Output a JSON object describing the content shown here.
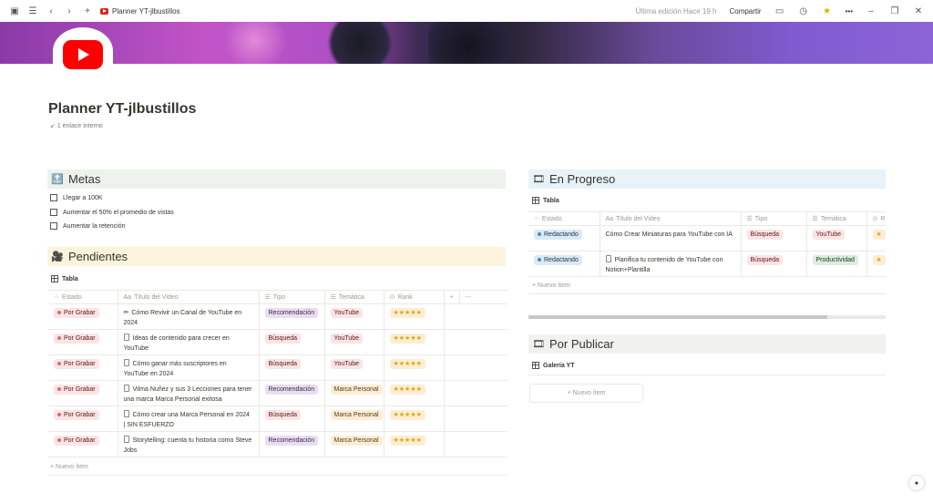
{
  "topbar": {
    "breadcrumb": "Planner YT-jlbustillos",
    "edited": "Última edición Hace 19 h",
    "share": "Compartir",
    "more": "•••",
    "minimize": "–",
    "restore": "❐",
    "close": "✕"
  },
  "page": {
    "title": "Planner YT-jlbustillos",
    "backlinks": "1 enlace interno"
  },
  "metas": {
    "heading": "Metas",
    "items": [
      "Llegar a 100K",
      "Aumentar el 50% el promedio de vistas",
      "Aumentar la retención"
    ]
  },
  "pendientes": {
    "heading": "Pendientes",
    "view": "Tabla",
    "columns": [
      "Estado",
      "Título del Video",
      "Tipo",
      "Temática",
      "Rank"
    ],
    "rows": [
      {
        "estado": "Por Grabar",
        "titulo": "Cómo Revivir un Canal de YouTube en 2024",
        "tipo": "Recomendación",
        "tematica": "YouTube",
        "rank": "★★★★★"
      },
      {
        "estado": "Por Grabar",
        "titulo": "Ideas de contenido para crecer en YouTube",
        "tipo": "Búsqueda",
        "tematica": "YouTube",
        "rank": "★★★★★"
      },
      {
        "estado": "Por Grabar",
        "titulo": "Cómo ganar más suscriptores en YouTube en 2024",
        "tipo": "Búsqueda",
        "tematica": "YouTube",
        "rank": "★★★★★"
      },
      {
        "estado": "Por Grabar",
        "titulo": "Vilma Nuñez y sus 3 Lecciones para tener una marca Marca Personal exitosa",
        "tipo": "Recomendación",
        "tematica": "Marca Personal",
        "rank": "★★★★★"
      },
      {
        "estado": "Por Grabar",
        "titulo": "Cómo crear una Marca Personal en 2024 | SIN ESFUERZO",
        "tipo": "Búsqueda",
        "tematica": "Marca Personal",
        "rank": "★★★★★"
      },
      {
        "estado": "Por Grabar",
        "titulo": "Storytelling: cuenta tu historia como Steve Jobs",
        "tipo": "Recomendación",
        "tematica": "Marca Personal",
        "rank": "★★★★★"
      }
    ],
    "new_item": "Nuevo ítem"
  },
  "progreso": {
    "heading": "En Progreso",
    "view": "Tabla",
    "columns": [
      "Estado",
      "Título del Video",
      "Tipo",
      "Temática",
      "R"
    ],
    "rows": [
      {
        "estado": "Redactando",
        "titulo": "Cómo Crear Miniaturas para YouTube con IA",
        "tipo": "Búsqueda",
        "tematica": "YouTube",
        "rank": "★"
      },
      {
        "estado": "Redactando",
        "titulo": "Planifica tu contenido de YouTube con Notion+Plantilla",
        "tipo": "Búsqueda",
        "tematica": "Productividad",
        "rank": "★"
      }
    ],
    "new_item": "Nuevo ítem"
  },
  "publicar": {
    "heading": "Por Publicar",
    "view": "Galería YT",
    "new_item": "Nuevo ítem"
  },
  "colors": {
    "metas_bg": "#edf3ec",
    "pendientes_bg": "#fbf3db",
    "progreso_bg": "#e7f3f8",
    "publicar_bg": "#f1f1ef"
  }
}
